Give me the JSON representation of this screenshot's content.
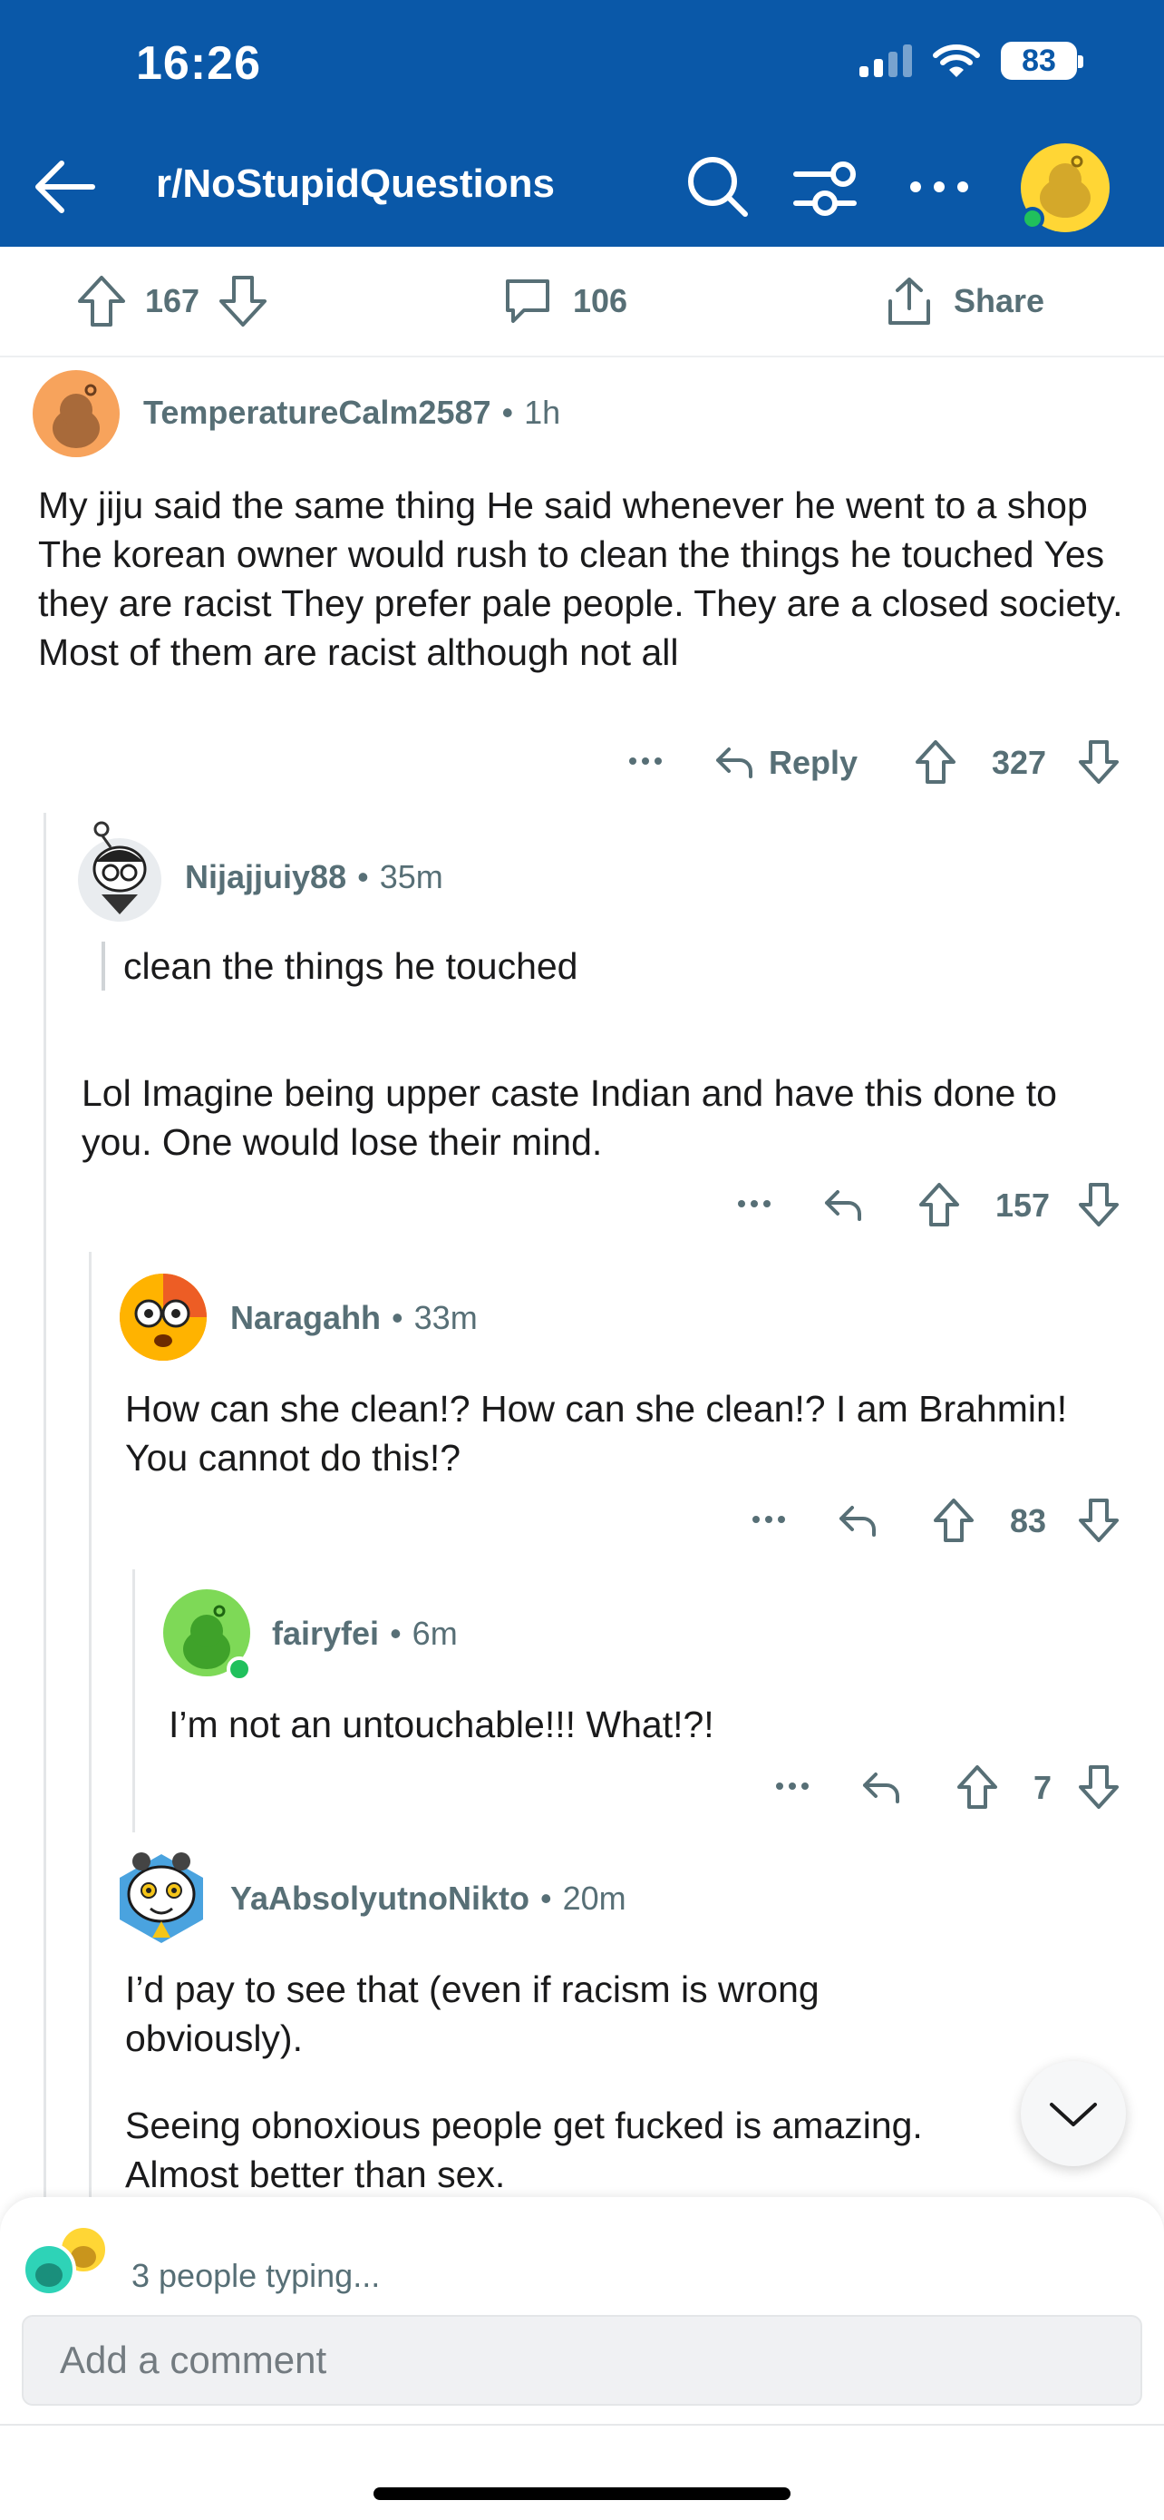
{
  "status_bar": {
    "time": "16:26",
    "battery": "83"
  },
  "nav": {
    "title": "r/NoStupidQuestions"
  },
  "post_actions": {
    "upvotes": "167",
    "comments": "106",
    "share_label": "Share"
  },
  "comments": [
    {
      "username": "TemperatureCalm2587",
      "time": "1h",
      "body": "My jiju said the same thing He said whenever he went to a shop The korean owner would rush to clean the things he touched Yes they are racist They prefer pale people. They are a closed society. Most of them are racist although not all",
      "reply_label": "Reply",
      "score": "327"
    },
    {
      "username": "Nijajjuiy88",
      "time": "35m",
      "quote": "clean the things he touched",
      "body": "Lol Imagine being upper caste Indian and have this done to you. One would lose their mind.",
      "score": "157"
    },
    {
      "username": "Naragahh",
      "time": "33m",
      "body": "How can she clean!? How can she clean!? I am Brahmin! You cannot do this!?",
      "score": "83"
    },
    {
      "username": "fairyfei",
      "time": "6m",
      "body": "I’m not an untouchable!!! What!?!",
      "score": "7"
    },
    {
      "username": "YaAbsolyutnoNikto",
      "time": "20m",
      "body1": "I’d pay to see that (even if racism is wrong obviously).",
      "body2": "Seeing obnoxious people get fucked is amazing. Almost better than sex."
    }
  ],
  "composer": {
    "typing": "3 people typing...",
    "placeholder": "Add a comment"
  },
  "colors": {
    "header": "#0a58a8",
    "meta": "#576f76",
    "online": "#20c05c"
  }
}
